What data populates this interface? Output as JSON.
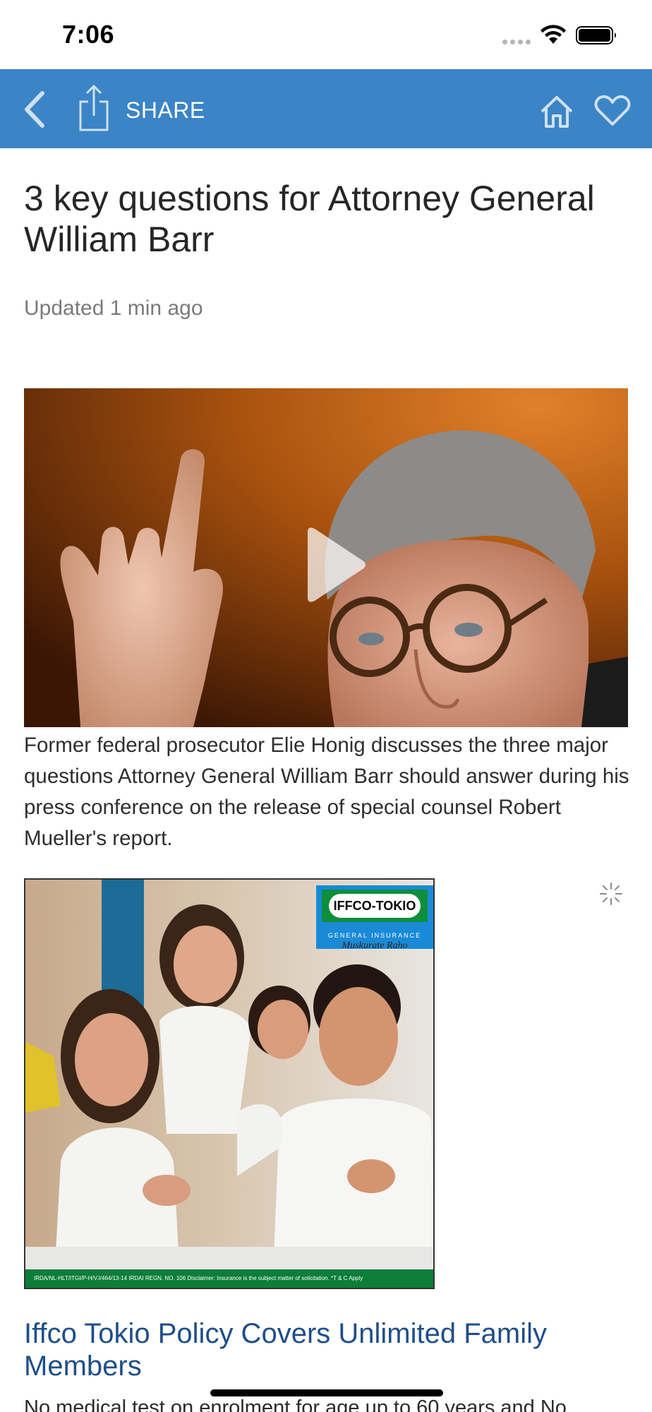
{
  "status_bar": {
    "time": "7:06"
  },
  "toolbar": {
    "share_label": "SHARE",
    "background_color": "#3b84c6",
    "icons": [
      "back-chevron-icon",
      "share-icon",
      "home-icon",
      "heart-icon"
    ]
  },
  "article": {
    "headline": "3 key questions for Attorney General William Barr",
    "updated": "Updated 1 min ago",
    "video_caption": "Former federal prosecutor Elie Honig discusses the three major questions Attorney General William Barr should answer during his press conference on the release of special counsel Robert Mueller's report."
  },
  "ad": {
    "brand_logo": "IFFCO-TOKIO",
    "brand_subtitle": "GENERAL INSURANCE",
    "tagline": "Muskurate Raho",
    "footer": "IRDA/NL-HLT/ITGI/P-H/V.I/464/13-14     IRDAI REGN. NO. 106     Disclaimer: Insurance is the subject matter of solicitation.     *T & C Apply",
    "title": "Iffco Tokio Policy Covers Unlimited Family Members",
    "description": "No medical test on enrolment for age up to 60 years and No",
    "title_color": "#1f4e8a"
  }
}
